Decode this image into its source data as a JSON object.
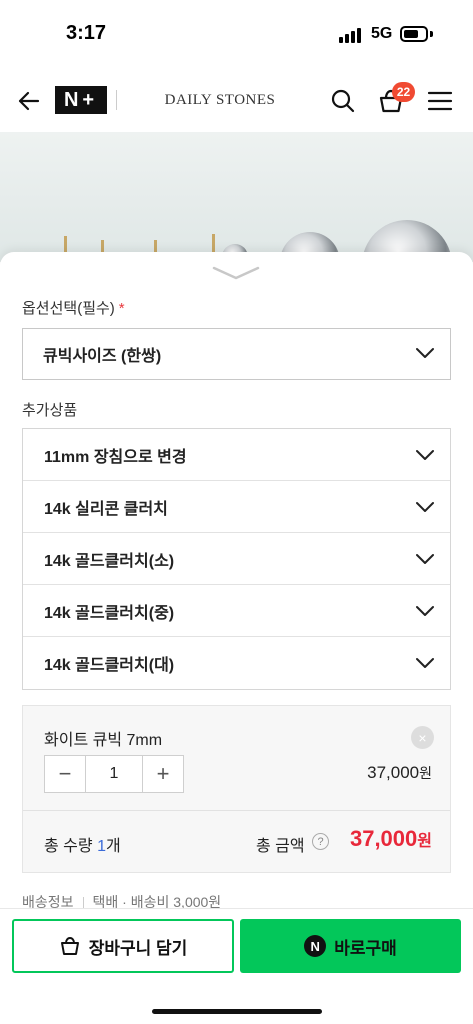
{
  "status_bar": {
    "time": "3:17",
    "network": "5G"
  },
  "header": {
    "logo_text": "N+",
    "brand": "DAILY STONES",
    "cart_count": "22"
  },
  "icons": {
    "back": "arrow-left-icon",
    "search": "search-icon",
    "cart": "shopping-bag-icon",
    "menu": "hamburger-menu-icon",
    "chevron": "chevron-down-icon"
  },
  "options": {
    "label": "옵션선택(필수)",
    "required_mark": "*",
    "selected": "큐빅사이즈 (한쌍)"
  },
  "addons": {
    "label": "추가상품",
    "items": [
      "11mm 장침으로 변경",
      "14k 실리콘 클러치",
      "14k 골드클러치(소)",
      "14k 골드클러치(중)",
      "14k 골드클러치(대)"
    ]
  },
  "selected_item": {
    "name": "화이트 큐빅 7mm",
    "quantity": "1",
    "price": "37,000",
    "price_unit": "원",
    "minus": "−",
    "plus": "+",
    "remove": "×"
  },
  "total": {
    "qty_label": "총 수량",
    "qty_value": "1",
    "qty_unit": "개",
    "amount_label": "총 금액",
    "help": "?",
    "amount": "37,000",
    "amount_unit": "원"
  },
  "shipping": {
    "label": "배송정보",
    "method": "택배 · 배송비 3,000원"
  },
  "actions": {
    "cart_label": "장바구니 담기",
    "buy_label": "바로구매",
    "npay_mark": "N"
  },
  "colors": {
    "accent_green": "#03c75a",
    "price_red": "#e8283a",
    "badge_red": "#f04a32",
    "qty_blue": "#3b6bd8"
  }
}
